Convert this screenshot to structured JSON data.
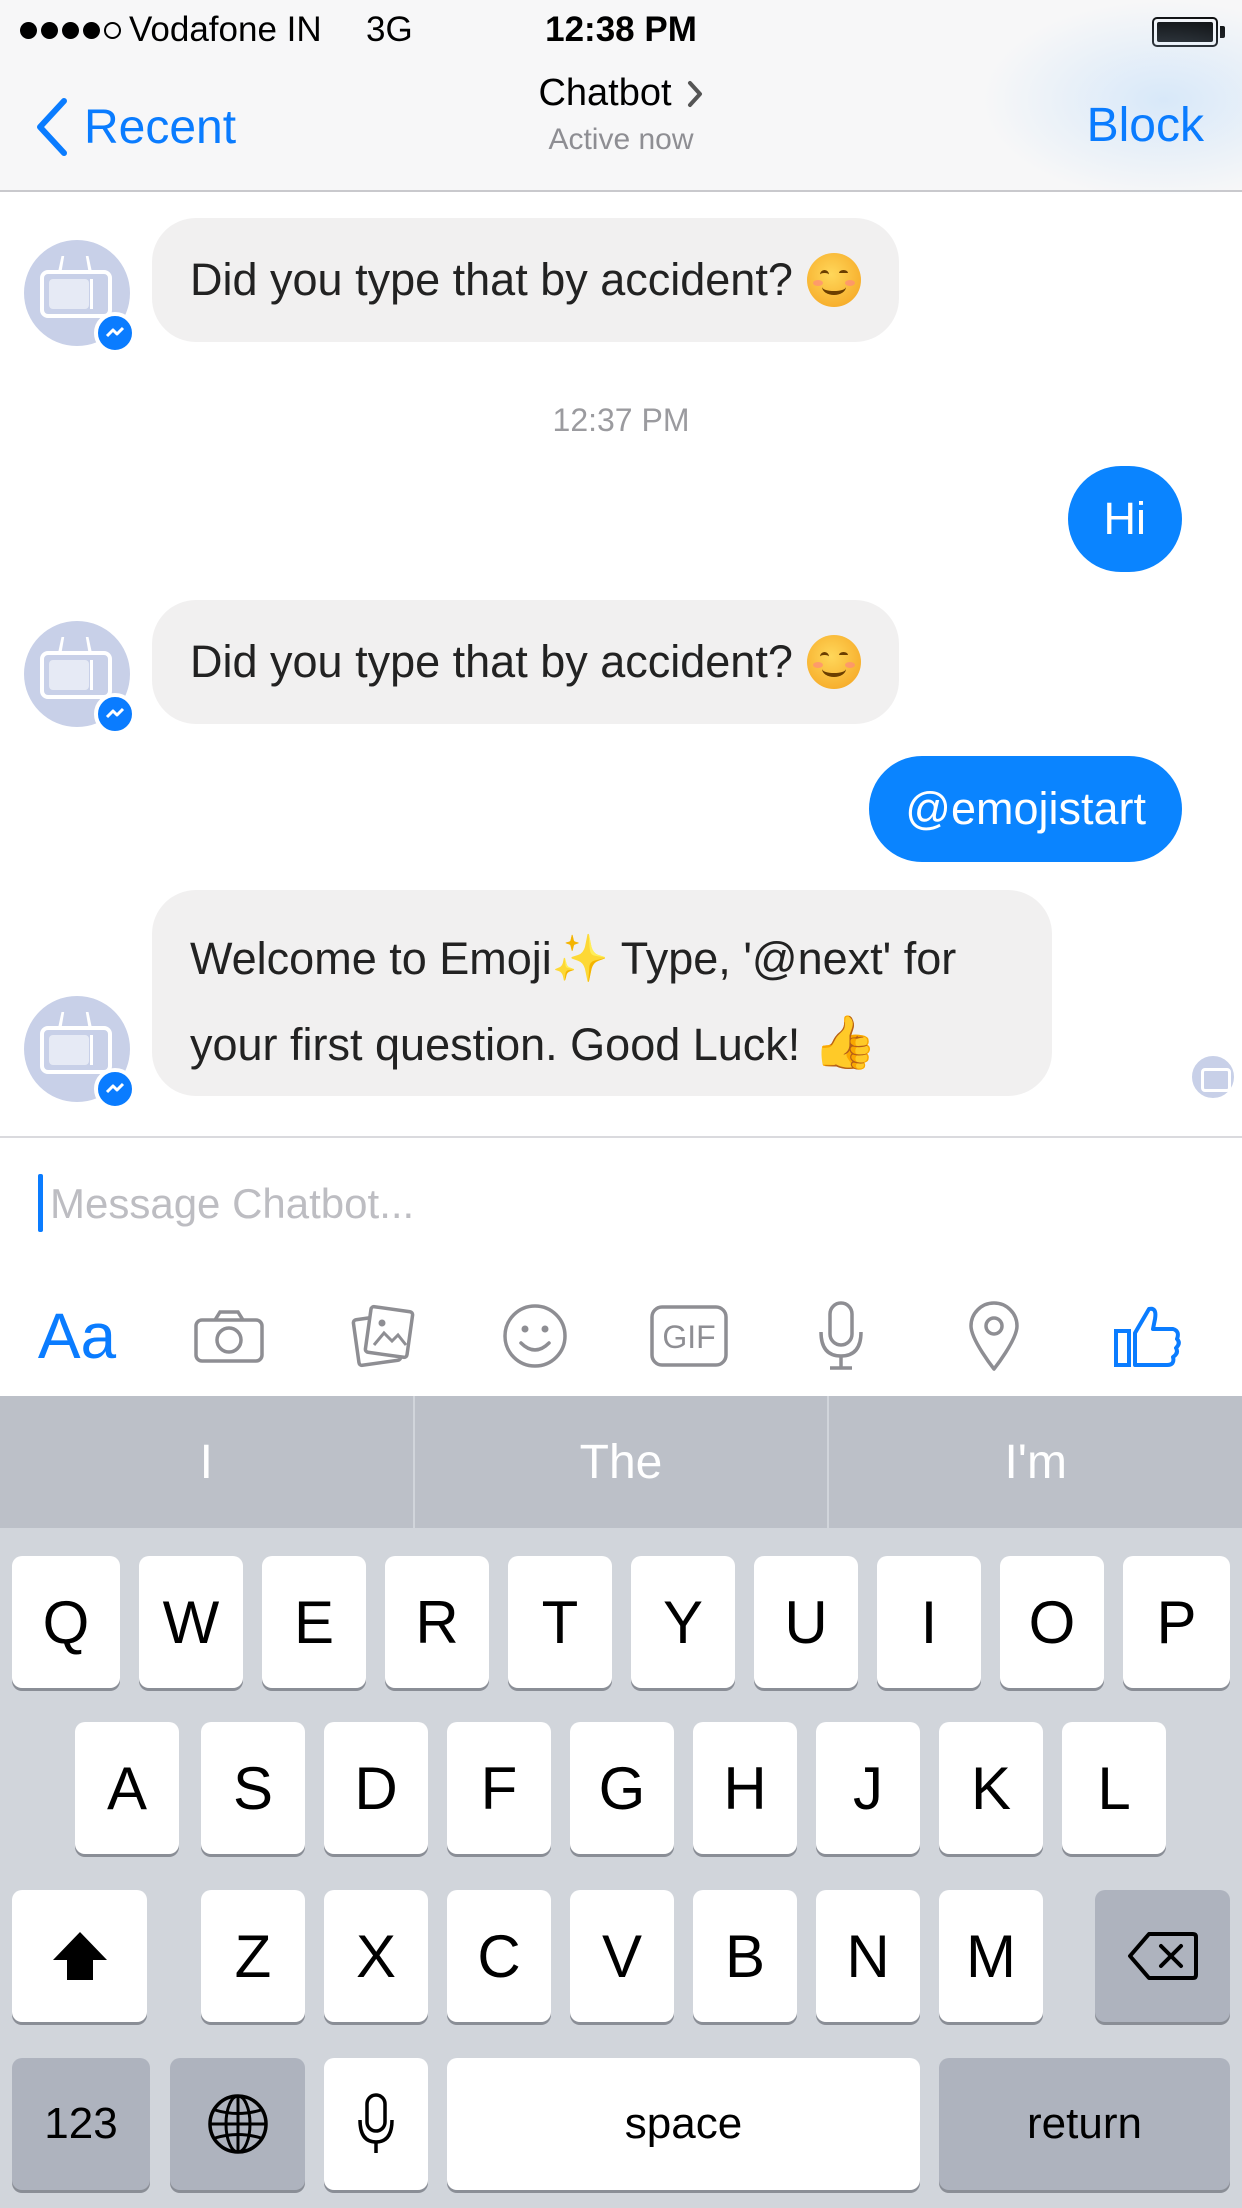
{
  "status_bar": {
    "carrier": "Vodafone IN",
    "network": "3G",
    "time": "12:38 PM",
    "signal_bars_filled": 4,
    "signal_bars_total": 5
  },
  "nav": {
    "back_label": "Recent",
    "title": "Chatbot",
    "subtitle": "Active now",
    "block_label": "Block"
  },
  "messages": {
    "m1_text": "Did you type that by accident?",
    "timestamp": "12:37 PM",
    "m2_text": "Hi",
    "m3_text": "Did you type that by accident?",
    "m4_text": "@emojistart",
    "m5_part1": "Welcome to Emoji",
    "m5_part2": " Type, '@next' for",
    "m5_line2": "your first question. Good Luck!"
  },
  "composer": {
    "placeholder": "Message Chatbot...",
    "value": "",
    "aa_label": "Aa",
    "gif_label": "GIF"
  },
  "keyboard": {
    "predictions": [
      "I",
      "The",
      "I'm"
    ],
    "row1": [
      "Q",
      "W",
      "E",
      "R",
      "T",
      "Y",
      "U",
      "I",
      "O",
      "P"
    ],
    "row2": [
      "A",
      "S",
      "D",
      "F",
      "G",
      "H",
      "J",
      "K",
      "L"
    ],
    "row3": [
      "Z",
      "X",
      "C",
      "V",
      "B",
      "N",
      "M"
    ],
    "numbers_label": "123",
    "space_label": "space",
    "return_label": "return"
  },
  "colors": {
    "accent": "#0a7cff",
    "outgoing_bubble": "#0a84ff",
    "incoming_bubble": "#f1f0f0",
    "keyboard_bg": "#d1d5db"
  },
  "icons": [
    "chevron-left-icon",
    "chevron-right-icon",
    "messenger-badge-icon",
    "camera-icon",
    "photo-icon",
    "smiley-icon",
    "gif-icon",
    "microphone-icon",
    "location-pin-icon",
    "thumbs-up-icon",
    "shift-icon",
    "backspace-icon",
    "globe-icon",
    "keyboard-mic-icon"
  ]
}
